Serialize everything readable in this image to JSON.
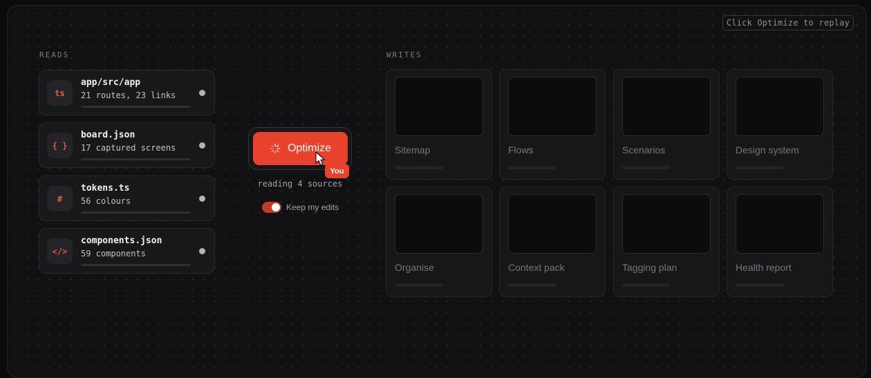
{
  "header": {
    "replay_hint": "Click Optimize to replay"
  },
  "reads": {
    "label": "READS",
    "items": [
      {
        "icon_text": "ts",
        "icon_name": "typescript-file-icon",
        "title": "app/src/app",
        "subtitle": "21 routes, 23 links"
      },
      {
        "icon_text": "{ }",
        "icon_name": "json-braces-icon",
        "title": "board.json",
        "subtitle": "17 captured screens"
      },
      {
        "icon_text": "#",
        "icon_name": "hash-icon",
        "title": "tokens.ts",
        "subtitle": "56 colours"
      },
      {
        "icon_text": "</>",
        "icon_name": "code-tag-icon",
        "title": "components.json",
        "subtitle": "59 components"
      }
    ]
  },
  "optimize": {
    "button_label": "Optimize",
    "cursor_badge": "You",
    "status": "reading 4 sources",
    "toggle_label": "Keep my edits",
    "toggle_on": true,
    "accent_color": "#e8412c"
  },
  "writes": {
    "label": "WRITES",
    "items": [
      {
        "title": "Sitemap"
      },
      {
        "title": "Flows"
      },
      {
        "title": "Scenarios"
      },
      {
        "title": "Design system"
      },
      {
        "title": "Organise"
      },
      {
        "title": "Context pack"
      },
      {
        "title": "Tagging plan"
      },
      {
        "title": "Health report"
      }
    ]
  }
}
